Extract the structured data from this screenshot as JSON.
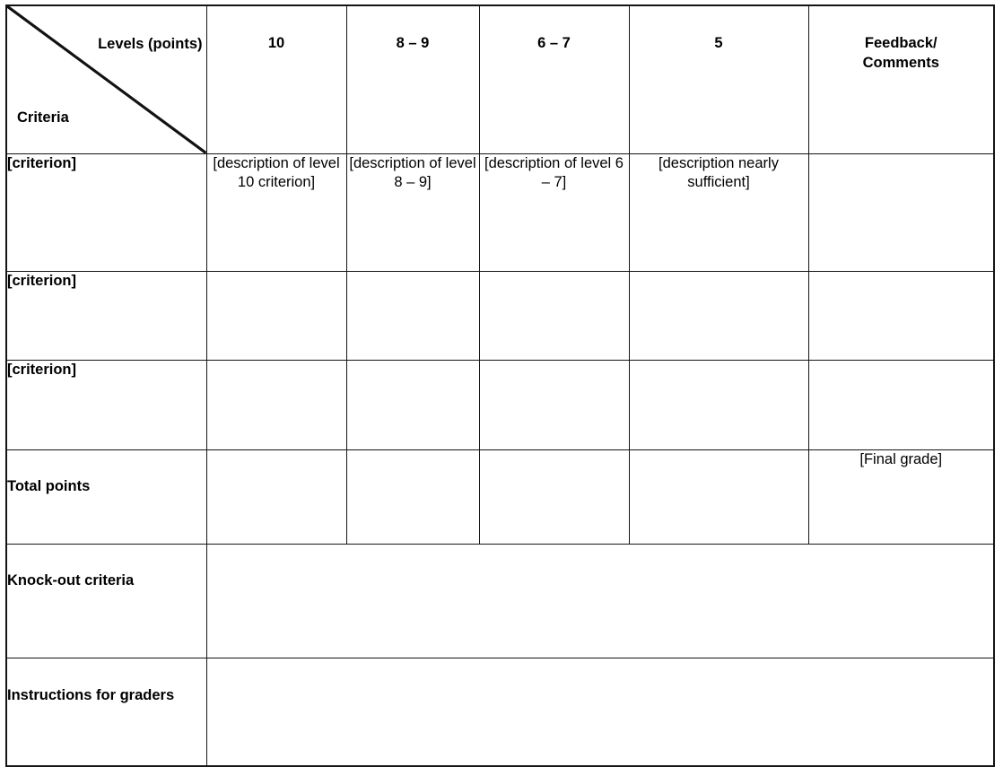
{
  "table": {
    "header": {
      "corner": {
        "levels_label": "Levels (points)",
        "criteria_label": "Criteria"
      },
      "columns": [
        {
          "label": "10"
        },
        {
          "label": "8 – 9"
        },
        {
          "label": "6 – 7"
        },
        {
          "label": "5"
        },
        {
          "label": "Feedback/\nComments"
        }
      ],
      "feedback_line1": "Feedback/",
      "feedback_line2": "Comments"
    },
    "rows": [
      {
        "label": "[criterion]",
        "cells": [
          "[description of level 10 criterion]",
          "[description of level 8 – 9]",
          "[description of level 6 – 7]",
          "[description nearly sufficient]",
          ""
        ]
      },
      {
        "label": "[criterion]",
        "cells": [
          "",
          "",
          "",
          "",
          ""
        ]
      },
      {
        "label": "[criterion]",
        "cells": [
          "",
          "",
          "",
          "",
          ""
        ]
      },
      {
        "label": "Total points",
        "cells": [
          "",
          "",
          "",
          "",
          "[Final grade]"
        ]
      },
      {
        "label": "Knock-out criteria",
        "cells": [
          ""
        ]
      },
      {
        "label": "Instructions for graders",
        "cells": [
          ""
        ]
      }
    ]
  },
  "colors": {
    "header_fill": "#f0f0f0",
    "label_fill": "#f0f0f0",
    "cell_fill": "#ffffff",
    "border": "#151515",
    "text": "#000000"
  }
}
